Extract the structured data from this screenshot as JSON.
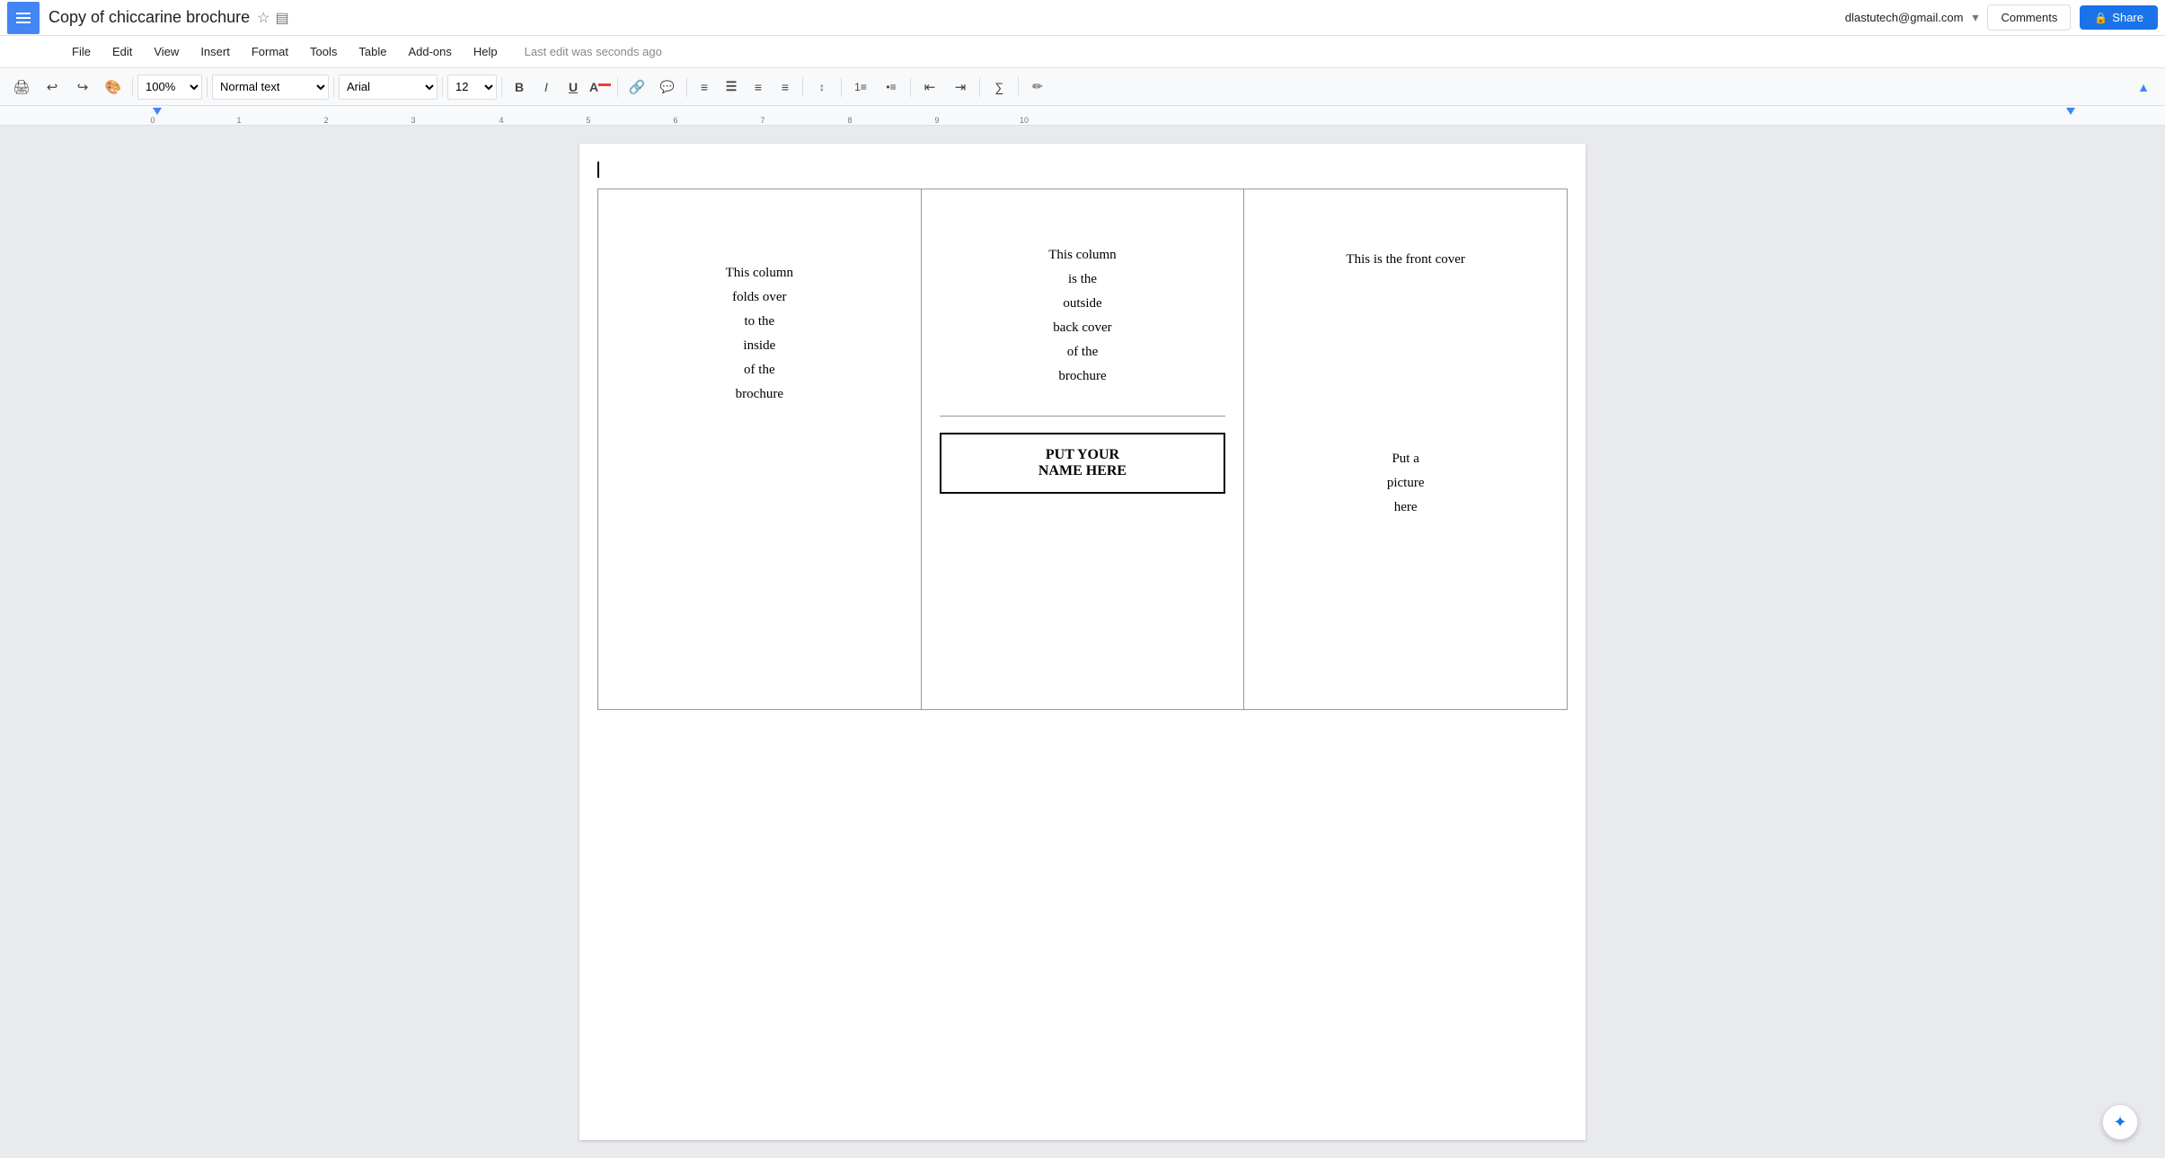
{
  "window": {
    "title": "Copy of chiccarine brochure",
    "user_email": "dlastutech@gmail.com"
  },
  "toolbar_top": {
    "star_icon": "★",
    "folder_icon": "📁",
    "comments_label": "Comments",
    "share_label": "Share",
    "lock_icon": "🔒"
  },
  "menu": {
    "items": [
      "File",
      "Edit",
      "View",
      "Insert",
      "Format",
      "Tools",
      "Table",
      "Add-ons",
      "Help"
    ],
    "last_edit": "Last edit was seconds ago"
  },
  "toolbar": {
    "zoom": "100%",
    "style": "Normal text",
    "font": "Arial",
    "size": "12",
    "bold": "B",
    "italic": "I",
    "underline": "U"
  },
  "document": {
    "col1": {
      "line1": "This column",
      "line2": "folds over",
      "line3": "to the",
      "line4": "inside",
      "line5": "of the",
      "line6": "brochure"
    },
    "col2": {
      "line1": "This column",
      "line2": "is the",
      "line3": "outside",
      "line4": "back cover",
      "line5": "of the",
      "line6": "brochure",
      "name_box": "PUT YOUR\nNAME HERE"
    },
    "col3": {
      "title": "This is the front cover",
      "picture_line1": "Put a",
      "picture_line2": "picture",
      "picture_line3": "here"
    }
  }
}
